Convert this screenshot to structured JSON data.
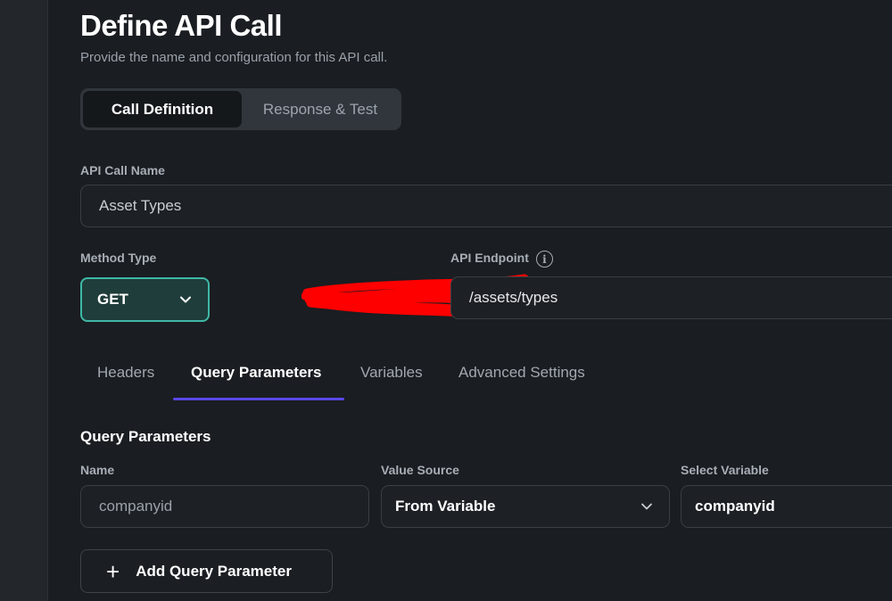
{
  "header": {
    "title": "Define API Call",
    "subtitle": "Provide the name and configuration for this API call."
  },
  "mode_tabs": {
    "active": "Call Definition",
    "inactive": "Response & Test"
  },
  "api_call_name": {
    "label": "API Call Name",
    "value": "Asset Types"
  },
  "method_type": {
    "label": "Method Type",
    "value": "GET"
  },
  "api_endpoint": {
    "label": "API Endpoint",
    "info_icon": "i",
    "value": "/assets/types"
  },
  "config_tabs": [
    {
      "label": "Headers",
      "active": false
    },
    {
      "label": "Query Parameters",
      "active": true
    },
    {
      "label": "Variables",
      "active": false
    },
    {
      "label": "Advanced Settings",
      "active": false
    }
  ],
  "query_params": {
    "section_title": "Query Parameters",
    "columns": {
      "name": "Name",
      "value_source": "Value Source",
      "select_variable": "Select Variable"
    },
    "rows": [
      {
        "name": "companyid",
        "value_source": "From Variable",
        "select_variable": "companyid"
      }
    ],
    "add_button": {
      "icon": "+",
      "label": "Add Query Parameter"
    }
  },
  "colors": {
    "background": "#1a1d21",
    "accent_teal": "#3fb8a6",
    "tab_underline": "#5848e8",
    "redaction": "#ff0000"
  },
  "icons": [
    "chevron-down-icon",
    "info-icon",
    "plus-icon"
  ]
}
